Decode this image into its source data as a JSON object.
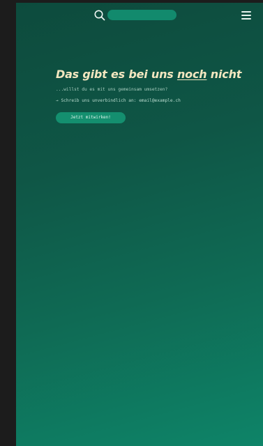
{
  "header": {
    "search_icon": "search-icon",
    "search_placeholder": "",
    "menu_icon": "hamburger-menu-icon"
  },
  "hero": {
    "headline_part1": "Das gibt es bei uns ",
    "headline_emphasis": "noch",
    "headline_part2": " nicht",
    "subline": "...willst du es mit uns gemeinsam umsetzen?",
    "contact": "→ Schreib uns unverbindlich an: email@example.ch",
    "cta_label": "Jetzt mitwirken!"
  },
  "colors": {
    "background_dark": "#1c1c1c",
    "screen_gradient_start": "#0d4b3d",
    "screen_gradient_end": "#0e8468",
    "accent": "#148f6f",
    "headline": "#f3e7c0"
  }
}
